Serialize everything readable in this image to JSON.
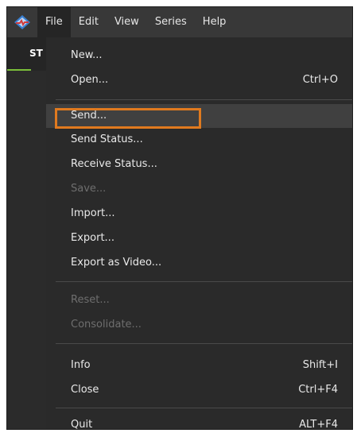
{
  "menubar": {
    "items": [
      "File",
      "Edit",
      "View",
      "Series",
      "Help"
    ]
  },
  "left_tab": {
    "label": "ST"
  },
  "file_menu": {
    "new": "New...",
    "open": "Open...",
    "open_shortcut": "Ctrl+O",
    "send": "Send...",
    "send_status": "Send Status...",
    "receive_status": "Receive Status...",
    "save": "Save...",
    "import": "Import...",
    "export": "Export...",
    "export_video": "Export as Video...",
    "reset": "Reset...",
    "consolidate": "Consolidate...",
    "info": "Info",
    "info_shortcut": "Shift+I",
    "close": "Close",
    "close_shortcut": "Ctrl+F4",
    "quit": "Quit",
    "quit_shortcut": "ALT+F4"
  },
  "colors": {
    "highlight": "#e07a1f",
    "tab_accent": "#7bbf3a"
  },
  "icons": {
    "app": "app-logo-icon"
  }
}
